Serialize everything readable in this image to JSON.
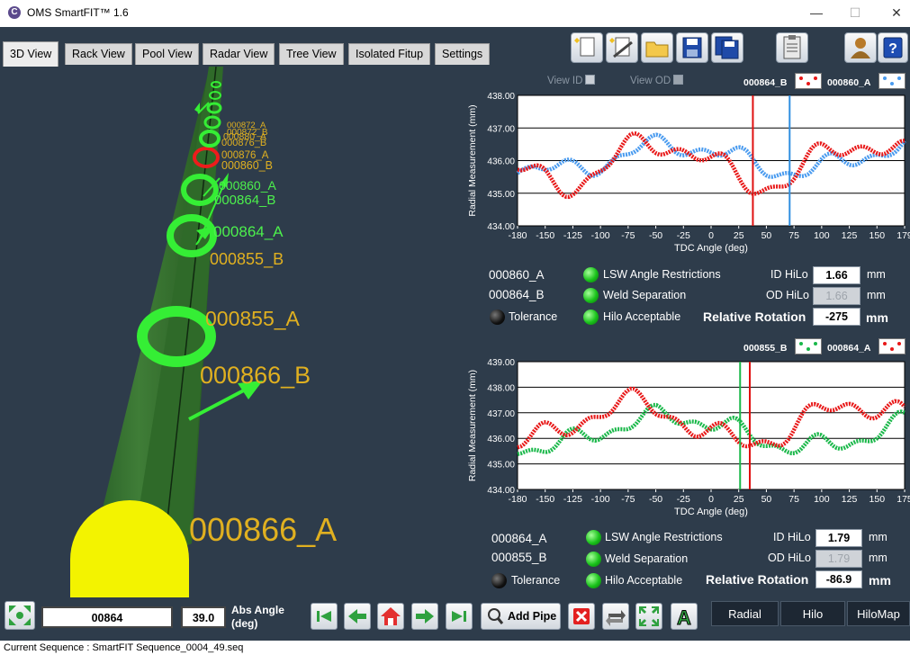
{
  "window": {
    "title": "OMS SmartFIT™ 1.6"
  },
  "tabs": [
    "3D View",
    "Rack View",
    "Pool View",
    "Radar View",
    "Tree View",
    "Isolated Fitup",
    "Settings"
  ],
  "view3d": {
    "labels_small": [
      "000872_A",
      "000872_B",
      "000880_A",
      "000876_B",
      "000876_A",
      "000860_B"
    ],
    "labels_main": [
      "000860_A",
      "000864_B",
      "000864_A",
      "000855_B",
      "000855_A",
      "000866_B",
      "000866_A"
    ]
  },
  "chart_top": {
    "view_id": "View ID",
    "view_od": "View OD",
    "legend": [
      "000864_B",
      "000860_A"
    ],
    "ylabel": "Radial Measurement (mm)",
    "xlabel": "TDC Angle (deg)",
    "yticks": [
      "438.00",
      "437.00",
      "436.00",
      "435.00",
      "434.00"
    ],
    "xticks": [
      "-180",
      "-150",
      "-125",
      "-100",
      "-75",
      "-50",
      "-25",
      "0",
      "25",
      "50",
      "75",
      "100",
      "125",
      "150",
      "179"
    ]
  },
  "chart_bottom": {
    "legend": [
      "000855_B",
      "000864_A"
    ],
    "ylabel": "Radial Measurement (mm)",
    "xlabel": "TDC Angle (deg)",
    "yticks": [
      "439.00",
      "438.00",
      "437.00",
      "436.00",
      "435.00",
      "434.00"
    ],
    "xticks": [
      "-180",
      "-150",
      "-125",
      "-100",
      "-75",
      "-50",
      "-25",
      "0",
      "25",
      "50",
      "75",
      "100",
      "125",
      "150",
      "175"
    ]
  },
  "fit_top": {
    "joint_a": "000860_A",
    "joint_b": "000864_B",
    "tolerance": "Tolerance",
    "lsw": "LSW Angle Restrictions",
    "weld": "Weld Separation",
    "hilo": "Hilo Acceptable",
    "id_hilo_label": "ID HiLo",
    "id_hilo": "1.66",
    "od_hilo_label": "OD HiLo",
    "od_hilo": "1.66",
    "unit": "mm",
    "rel_rot_label": "Relative Rotation",
    "rel_rot": "-275"
  },
  "fit_bottom": {
    "joint_a": "000864_A",
    "joint_b": "000855_B",
    "tolerance": "Tolerance",
    "lsw": "LSW Angle Restrictions",
    "weld": "Weld Separation",
    "hilo": "Hilo Acceptable",
    "id_hilo_label": "ID HiLo",
    "id_hilo": "1.79",
    "od_hilo_label": "OD HiLo",
    "od_hilo": "1.79",
    "unit": "mm",
    "rel_rot_label": "Relative Rotation",
    "rel_rot": "-86.9"
  },
  "bottom": {
    "joint_field": "00864",
    "angle_field": "39.0",
    "abs_angle_label_1": "Abs Angle",
    "abs_angle_label_2": "(deg)",
    "add_pipe": "Add Pipe",
    "tabs": [
      "Radial",
      "Hilo",
      "HiloMap"
    ]
  },
  "status": {
    "text": "Current Sequence :  SmartFIT Sequence_0004_49.seq"
  },
  "colors": {
    "panel": "#2e3c4b",
    "pipe": "#2d6b27",
    "ring_green": "#35ee35",
    "ring_red": "#ee1c1c",
    "label_gold": "#e0b020",
    "label_green": "#4cf04c",
    "series_red": "#e81818",
    "series_blue": "#4a9bef",
    "series_green": "#1ab84a",
    "rotation_line_red": "#e01010",
    "rotation_line_blue": "#2f8fe0",
    "rotation_line_green": "#1ab84a"
  }
}
